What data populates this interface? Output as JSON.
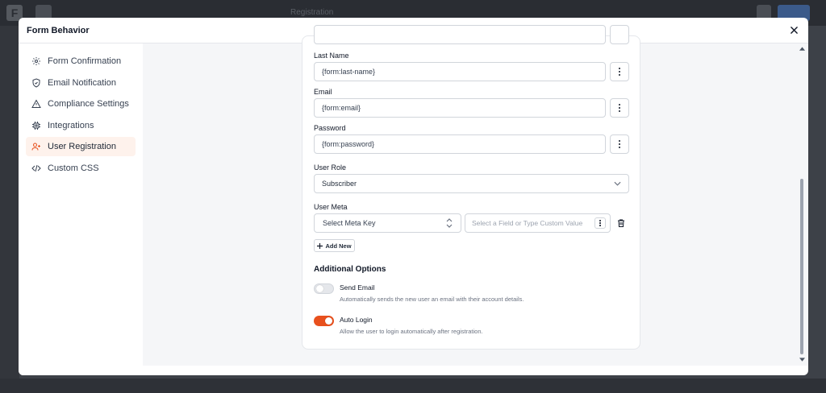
{
  "background": {
    "logo": "F",
    "title": "Registration"
  },
  "modal": {
    "title": "Form Behavior",
    "close_icon": "close-icon"
  },
  "sidebar": {
    "items": [
      {
        "label": "Form Confirmation",
        "icon": "gear-icon"
      },
      {
        "label": "Email Notification",
        "icon": "shield-icon"
      },
      {
        "label": "Compliance Settings",
        "icon": "warning-icon"
      },
      {
        "label": "Integrations",
        "icon": "chip-icon"
      },
      {
        "label": "User Registration",
        "icon": "user-plus-icon",
        "active": true
      },
      {
        "label": "Custom CSS",
        "icon": "code-icon"
      }
    ]
  },
  "form": {
    "last_name": {
      "label": "Last Name",
      "value": "{form:last-name}"
    },
    "email": {
      "label": "Email",
      "value": "{form:email}"
    },
    "password": {
      "label": "Password",
      "value": "{form:password}"
    },
    "user_role": {
      "label": "User Role",
      "value": "Subscriber"
    },
    "user_meta": {
      "label": "User Meta",
      "key_placeholder": "Select Meta Key",
      "value_placeholder": "Select a Field or Type Custom Value",
      "add_new": "Add New"
    },
    "additional_options": {
      "title": "Additional Options",
      "send_email": {
        "label": "Send Email",
        "description": "Automatically sends the new user an email with their account details.",
        "enabled": false
      },
      "auto_login": {
        "label": "Auto Login",
        "description": "Allow the user to login automatically after registration.",
        "enabled": true
      }
    }
  },
  "colors": {
    "accent": "#e8501d",
    "active_bg": "#fef2ec"
  }
}
